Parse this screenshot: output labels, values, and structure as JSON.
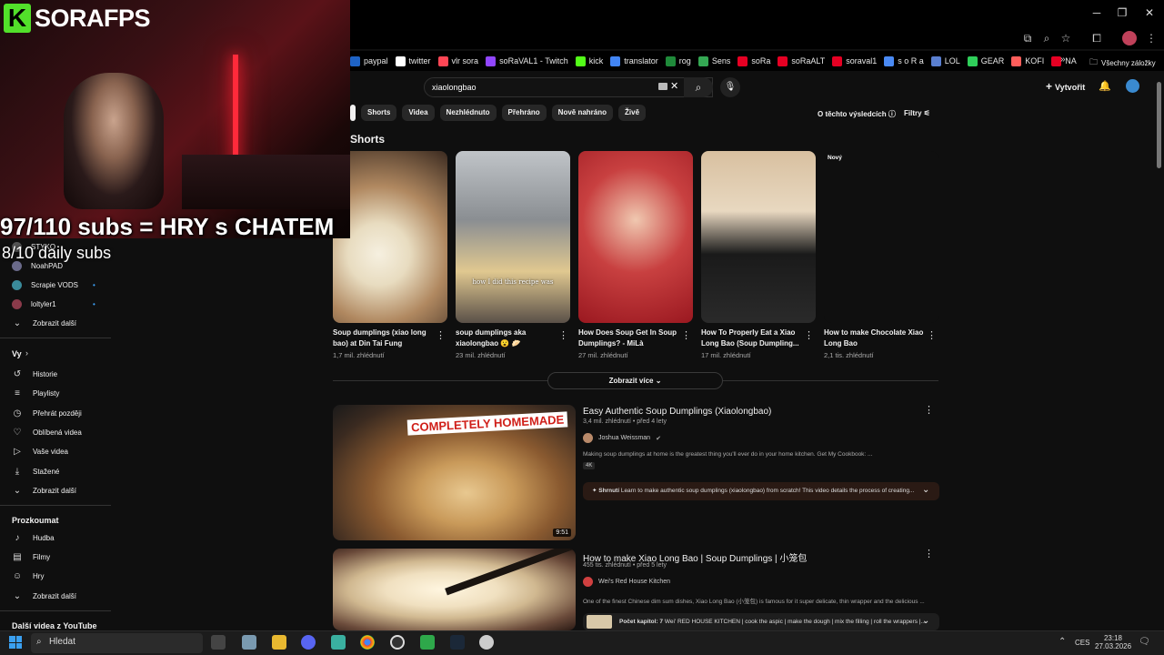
{
  "overlay": {
    "logo_k": "K",
    "logo_text": "SORAFPS",
    "subs_line": "97/110 subs = HRY s CHATEM",
    "daily_line": "8/10 daily subs"
  },
  "bookmarks": [
    {
      "label": "paypal",
      "color": "#1e63c6"
    },
    {
      "label": "twitter",
      "color": "#ffffff"
    },
    {
      "label": "vlr sora",
      "color": "#ff4655"
    },
    {
      "label": "soRaVAL1 - Twitch",
      "color": "#9146ff"
    },
    {
      "label": "kick",
      "color": "#53fc18"
    },
    {
      "label": "translator",
      "color": "#4285f4"
    },
    {
      "label": "rog",
      "color": "#1f8a3a"
    },
    {
      "label": "Sens",
      "color": "#34a853"
    },
    {
      "label": "soRa",
      "color": "#e60023"
    },
    {
      "label": "soRaALT",
      "color": "#e60023"
    },
    {
      "label": "soraval1",
      "color": "#e60023"
    },
    {
      "label": "s o R a",
      "color": "#4a8af4"
    },
    {
      "label": "LOL",
      "color": "#5a7fd0"
    },
    {
      "label": "GEAR",
      "color": "#2fcf5a"
    },
    {
      "label": "KOFI",
      "color": "#ff5e5b"
    },
    {
      "label": "NA",
      "color": "#e60023"
    }
  ],
  "bookmarks_more": "»",
  "all_bookmarks": "Všechny záložky",
  "search": {
    "value": "xiaolongbao"
  },
  "header": {
    "create": "Vytvořit"
  },
  "chips": [
    "Shorts",
    "Videa",
    "Nezhlédnuto",
    "Přehráno",
    "Nově nahráno",
    "Živě"
  ],
  "results_count": "O těchto výsledcích",
  "filters": "Filtry",
  "sidebar": {
    "subs": [
      {
        "label": "STYKO"
      },
      {
        "label": "NoahPAD"
      },
      {
        "label": "Scrapie VODS"
      },
      {
        "label": "loltyler1"
      }
    ],
    "show_more_1": "Zobrazit další",
    "you_header": "Vy",
    "you_items": [
      {
        "label": "Historie",
        "icon": "history-icon"
      },
      {
        "label": "Playlisty",
        "icon": "playlist-icon"
      },
      {
        "label": "Přehrát později",
        "icon": "watch-later-icon"
      },
      {
        "label": "Oblíbená videa",
        "icon": "like-icon"
      },
      {
        "label": "Vaše videa",
        "icon": "your-videos-icon"
      },
      {
        "label": "Stažené",
        "icon": "download-icon"
      }
    ],
    "show_more_2": "Zobrazit další",
    "explore_header": "Prozkoumat",
    "explore_items": [
      {
        "label": "Hudba",
        "icon": "music-icon"
      },
      {
        "label": "Filmy",
        "icon": "movies-icon"
      },
      {
        "label": "Hry",
        "icon": "games-icon"
      }
    ],
    "show_more_3": "Zobrazit další",
    "more_header": "Další videa z YouTube"
  },
  "shorts": {
    "title": "Shorts",
    "items": [
      {
        "title": "Soup dumplings (xiao long bao) at Din Tai Fung",
        "views": "1,7 mil. zhlédnutí"
      },
      {
        "title": "soup dumplings aka xiaolongbao 😮 🥟",
        "views": "23 mil. zhlédnutí",
        "caption": "how I did this recipe was"
      },
      {
        "title": "How Does Soup Get In Soup Dumplings? - MiLà",
        "views": "27 mil. zhlédnutí"
      },
      {
        "title": "How To Properly Eat a Xiao Long Bao (Soup Dumpling...",
        "views": "17 mil. zhlédnutí"
      },
      {
        "title": "How to make Chocolate Xiao Long Bao",
        "views": "2,1 tis. zhlédnutí",
        "badge": "Nový"
      }
    ],
    "show_more": "Zobrazit více"
  },
  "videos": [
    {
      "title": "Easy Authentic Soup Dumplings (Xiaolongbao)",
      "meta": "3,4 mil. zhlédnutí • před 4 lety",
      "channel": "Joshua Weissman",
      "desc": "Making soup dumplings at home is the greatest thing you'll ever do in your home kitchen. Get My Cookbook: ...",
      "badge": "4K",
      "summary_label": "Shrnutí",
      "summary": "Learn to make authentic soup dumplings (xiaolongbao) from scratch! This video details the process of creating...",
      "duration": "9:51",
      "thumb_text": "COMPLETELY HOMEMADE"
    },
    {
      "title": "How to make Xiao Long Bao | Soup Dumplings | 小笼包",
      "meta": "455 tis. zhlédnutí • před 5 lety",
      "channel": "Wei's Red House Kitchen",
      "desc": "One of the finest Chinese dim sum dishes, Xiao Long Bao (小笼包) is famous for it super delicate, thin wrapper and the delicious ...",
      "summary_label": "Počet kapitol: 7",
      "summary": "Wei' RED HOUSE KITCHEN | cook the aspic | make the dough | mix the filling | roll the wrappers |..."
    }
  ],
  "taskbar": {
    "search": "Hledat",
    "lang": "CES",
    "time": "23:18",
    "date": "27.03.2026"
  }
}
